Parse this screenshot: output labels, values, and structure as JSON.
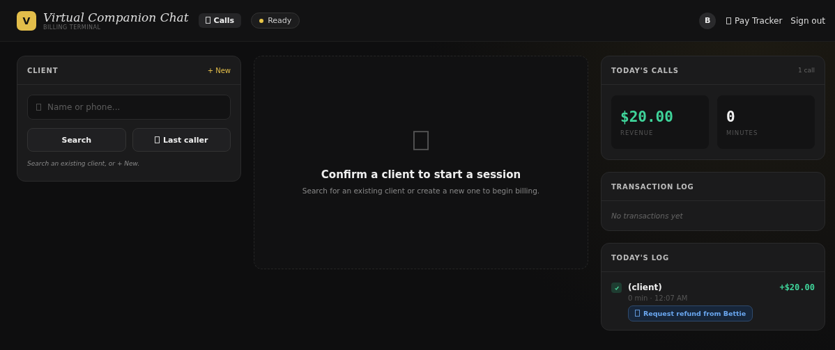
{
  "header": {
    "logo_letter": "V",
    "title": "Virtual Companion Chat",
    "subtitle": "BILLING TERMINAL",
    "calls_button": "Calls",
    "status": {
      "label": "Ready",
      "color": "#e8c547"
    },
    "avatar": "B",
    "pay_tracker": "Pay Tracker",
    "sign_out": "Sign out"
  },
  "client": {
    "title": "CLIENT",
    "new_link": "+ New",
    "search": {
      "placeholder": "Name or phone..."
    },
    "search_button": "Search",
    "last_caller_button": "Last caller",
    "hint": "Search an existing client, or + New."
  },
  "session": {
    "title": "Confirm a client to start a session",
    "text": "Search for an existing client or create a new one to begin billing."
  },
  "todays_calls": {
    "title": "TODAY'S CALLS",
    "count": "1 call",
    "stats": [
      {
        "value": "$20.00",
        "label": "REVENUE",
        "kind": "money"
      },
      {
        "value": "0",
        "label": "MINUTES",
        "kind": "plain"
      }
    ]
  },
  "transaction_log": {
    "title": "TRANSACTION LOG",
    "empty": "No transactions yet"
  },
  "todays_log": {
    "title": "TODAY'S LOG",
    "entries": [
      {
        "checked": true,
        "name": "(client)",
        "meta": "0 min · 12:07 AM",
        "amount": "+$20.00",
        "action": "Request refund from Bettie"
      }
    ]
  }
}
